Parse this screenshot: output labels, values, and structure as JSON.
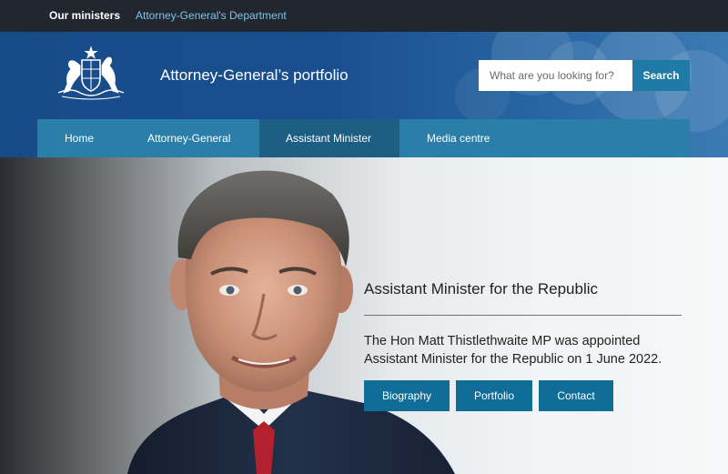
{
  "topbar": {
    "active_label": "Our ministers",
    "department_link": "Attorney-General's Department"
  },
  "header": {
    "title": "Attorney-General’s portfolio",
    "search": {
      "placeholder": "What are you looking for?",
      "button_label": "Search"
    }
  },
  "nav": {
    "items": [
      {
        "label": "Home"
      },
      {
        "label": "Attorney-General"
      },
      {
        "label": "Assistant Minister",
        "active": true
      },
      {
        "label": "Media centre"
      }
    ]
  },
  "hero": {
    "heading": "Assistant Minister for the Republic",
    "text": "The Hon Matt Thistlethwaite MP was appointed Assistant Minister for the Republic on 1 June 2022.",
    "buttons": [
      {
        "label": "Biography"
      },
      {
        "label": "Portfolio"
      },
      {
        "label": "Contact"
      }
    ]
  },
  "colors": {
    "topbar": "#22262e",
    "header": "#1a4f8f",
    "nav": "#2a7fa9",
    "nav_active": "#1d5e82",
    "search_button": "#1f7aa8",
    "hero_button": "#106d98"
  },
  "icons": {
    "crest": "coat-of-arms-icon"
  }
}
